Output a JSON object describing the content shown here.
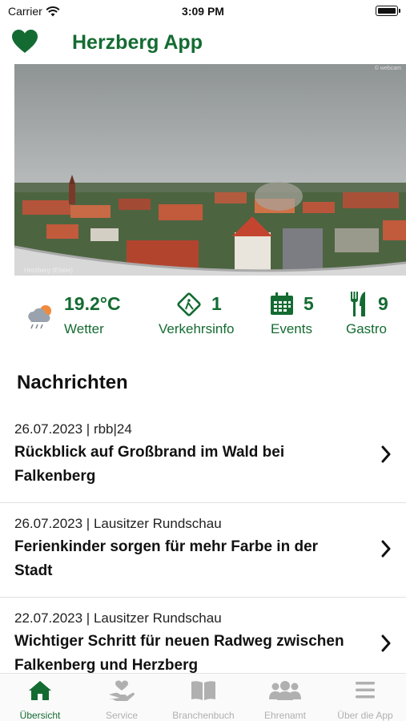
{
  "status_bar": {
    "carrier": "Carrier",
    "time": "3:09 PM"
  },
  "header": {
    "title": "Herzberg App",
    "icon": "heart-icon"
  },
  "webcam": {
    "caption": "Herzberg (Elster)",
    "credit": "© webcam"
  },
  "info_bar": {
    "weather": {
      "value": "19.2°C",
      "label": "Wetter",
      "icon": "cloud-sun-rain-icon"
    },
    "traffic": {
      "value": "1",
      "label": "Verkehrsinfo",
      "icon": "roadwork-sign-icon"
    },
    "events": {
      "value": "5",
      "label": "Events",
      "icon": "calendar-icon"
    },
    "gastro": {
      "value": "9",
      "label": "Gastro",
      "icon": "fork-knife-icon"
    }
  },
  "news": {
    "title": "Nachrichten",
    "items": [
      {
        "meta": "26.07.2023 | rbb|24",
        "line1": "Rückblick auf Großbrand im Wald bei",
        "line2": "Falkenberg"
      },
      {
        "meta": "26.07.2023 | Lausitzer Rundschau",
        "line1": "Ferienkinder sorgen für mehr Farbe in der",
        "line2": "Stadt"
      },
      {
        "meta": "22.07.2023 | Lausitzer Rundschau",
        "line1": "Wichtiger Schritt für neuen Radweg zwischen",
        "line2": "Falkenberg und Herzberg"
      }
    ]
  },
  "tabs": [
    {
      "label": "Übersicht",
      "icon": "home-icon",
      "active": true
    },
    {
      "label": "Service",
      "icon": "hand-heart-icon"
    },
    {
      "label": "Branchenbuch",
      "icon": "book-icon"
    },
    {
      "label": "Ehrenamt",
      "icon": "people-icon"
    },
    {
      "label": "Über die App",
      "icon": "menu-icon"
    }
  ],
  "colors": {
    "brand": "#146b32",
    "inactive": "#b0b0b0"
  }
}
